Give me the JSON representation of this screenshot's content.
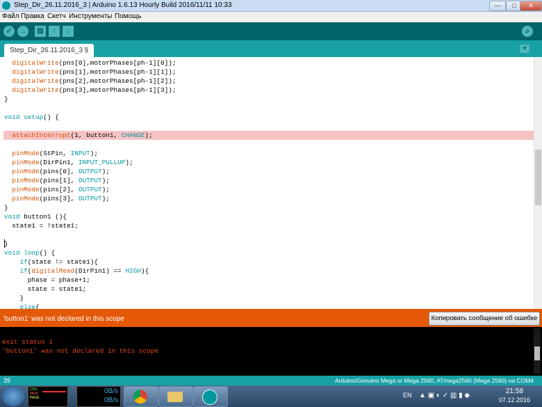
{
  "window": {
    "title": "Step_Dir_26.11.2016_3 | Arduino 1.6.13 Hourly Build 2016/11/11 10:33",
    "controls": {
      "minimize": "—",
      "maximize": "□",
      "close": "✕"
    }
  },
  "menu": [
    "Файл",
    "Правка",
    "Скетч",
    "Инструменты",
    "Помощь"
  ],
  "toolbar": {
    "verify": "✓",
    "upload": "→",
    "new": "▤",
    "open": "↑",
    "save": "↓",
    "serial_monitor": "⌕"
  },
  "tab": {
    "label": "Step_Dir_26.11.2016_3 §",
    "menu_arrow": "▼"
  },
  "code": [
    [
      [
        "fn",
        "  digitalWrite"
      ],
      [
        "t",
        "(pns[0],motorPhases[ph-1][0]);"
      ]
    ],
    [
      [
        "fn",
        "  digitalWrite"
      ],
      [
        "t",
        "(pns[1],motorPhases[ph-1][1]);"
      ]
    ],
    [
      [
        "fn",
        "  digitalWrite"
      ],
      [
        "t",
        "(pns[2],motorPhases[ph-1][2]);"
      ]
    ],
    [
      [
        "fn",
        "  digitalWrite"
      ],
      [
        "t",
        "(pns[3],motorPhases[ph-1][3]);"
      ]
    ],
    [
      [
        "t",
        "}"
      ]
    ],
    [
      [
        "t",
        ""
      ]
    ],
    [
      [
        "ty",
        "void"
      ],
      [
        "t",
        " "
      ],
      [
        "kw",
        "setup"
      ],
      [
        "t",
        "() {"
      ]
    ],
    [
      [
        "t",
        ""
      ]
    ],
    [
      [
        "fn",
        "  attachInterrupt"
      ],
      [
        "t",
        "(1, button1, "
      ],
      [
        "kw",
        "CHANGE"
      ],
      [
        "t",
        ");"
      ]
    ],
    [
      [
        "t",
        ""
      ]
    ],
    [
      [
        "fn",
        "  pinMode"
      ],
      [
        "t",
        "(StPin, "
      ],
      [
        "kw",
        "INPUT"
      ],
      [
        "t",
        ");"
      ]
    ],
    [
      [
        "fn",
        "  pinMode"
      ],
      [
        "t",
        "(DirPin1, "
      ],
      [
        "kw",
        "INPUT_PULLUP"
      ],
      [
        "t",
        ");"
      ]
    ],
    [
      [
        "fn",
        "  pinMode"
      ],
      [
        "t",
        "(pins[0], "
      ],
      [
        "kw",
        "OUTPUT"
      ],
      [
        "t",
        ");"
      ]
    ],
    [
      [
        "fn",
        "  pinMode"
      ],
      [
        "t",
        "(pins[1], "
      ],
      [
        "kw",
        "OUTPUT"
      ],
      [
        "t",
        ");"
      ]
    ],
    [
      [
        "fn",
        "  pinMode"
      ],
      [
        "t",
        "(pins[2], "
      ],
      [
        "kw",
        "OUTPUT"
      ],
      [
        "t",
        ");"
      ]
    ],
    [
      [
        "fn",
        "  pinMode"
      ],
      [
        "t",
        "(pins[3], "
      ],
      [
        "kw",
        "OUTPUT"
      ],
      [
        "t",
        ");"
      ]
    ],
    [
      [
        "t",
        "}"
      ]
    ],
    [
      [
        "ty",
        "void"
      ],
      [
        "t",
        " button1 (){"
      ]
    ],
    [
      [
        "t",
        "  state1 = !state1;"
      ]
    ],
    [
      [
        "t",
        ""
      ]
    ],
    [
      [
        "t",
        "}"
      ]
    ],
    [
      [
        "ty",
        "void"
      ],
      [
        "t",
        " "
      ],
      [
        "kw",
        "loop"
      ],
      [
        "t",
        "() {"
      ]
    ],
    [
      [
        "kw",
        "    if"
      ],
      [
        "t",
        "(state != state1){"
      ]
    ],
    [
      [
        "kw",
        "    if"
      ],
      [
        "t",
        "("
      ],
      [
        "fn",
        "digitalRead"
      ],
      [
        "t",
        "(DirPin1) == "
      ],
      [
        "kw",
        "HIGH"
      ],
      [
        "t",
        "){"
      ]
    ],
    [
      [
        "t",
        "      phase = phase+1;"
      ]
    ],
    [
      [
        "t",
        "      state = state1;"
      ]
    ],
    [
      [
        "t",
        "    }"
      ]
    ],
    [
      [
        "kw",
        "    else"
      ],
      [
        "t",
        "{"
      ]
    ]
  ],
  "highlight_line": 8,
  "error": {
    "message": "'button1' was not declared in this scope",
    "copy_button": "Копировать сообщение об ошибке"
  },
  "console": [
    "exit status 1",
    "'button1' was not declared in this scope"
  ],
  "status": {
    "line": "39",
    "board": "Arduino/Genuino Mega or Mega 2560, ATmega2560 (Mega 2560) на COM4"
  },
  "taskbar": {
    "net_rate_1": "0B/s",
    "net_rate_2": "0B/s",
    "gadget_labels": [
      "CPU",
      "MEM",
      "PAGE"
    ],
    "lang": "EN",
    "time": "21:58",
    "date": "07.12.2016"
  },
  "colors": {
    "teal_dark": "#006468",
    "teal": "#17a1a5",
    "error_orange": "#e35908",
    "highlight": "#f6c3c3"
  }
}
